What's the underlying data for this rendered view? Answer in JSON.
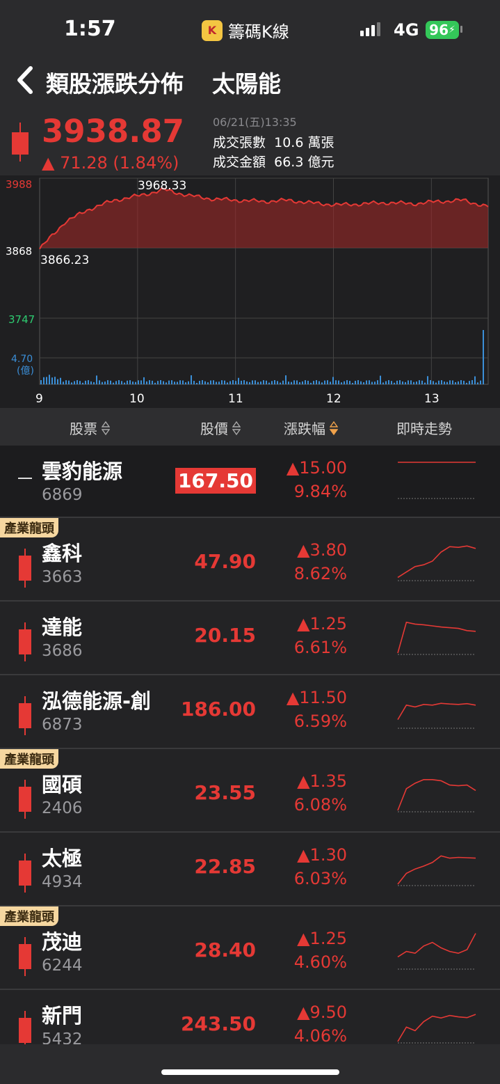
{
  "status": {
    "time": "1:57",
    "app_name": "籌碼K線",
    "network": "4G",
    "battery": "96"
  },
  "nav": {
    "title": "類股漲跌分佈",
    "sector": "太陽能"
  },
  "quote": {
    "price": "3938.87",
    "change": "▲ 71.28 (1.84%)",
    "time": "06/21(五)13:35",
    "volume_label": "成交張數",
    "volume": "10.6 萬張",
    "amount_label": "成交金額",
    "amount": "66.3 億元"
  },
  "chart": {
    "y_top": "3988",
    "y_mid": "3868",
    "y_low": "3747",
    "high_label": "3968.33",
    "low_label": "3866.23",
    "vol_label": "4.70",
    "vol_unit": "(億)",
    "x_labels": [
      "9",
      "10",
      "11",
      "12",
      "13"
    ]
  },
  "chart_data": {
    "type": "area",
    "ylim": [
      3747,
      3988
    ],
    "reference": 3868,
    "high": 3968.33,
    "low": 3866.23,
    "x": [
      "9:00",
      "9:15",
      "9:30",
      "9:45",
      "10:00",
      "10:15",
      "10:30",
      "10:45",
      "11:00",
      "11:15",
      "11:30",
      "11:45",
      "12:00",
      "12:15",
      "12:30",
      "12:45",
      "13:00",
      "13:15",
      "13:30"
    ],
    "values": [
      3866.23,
      3912,
      3935,
      3950,
      3958,
      3968.33,
      3958,
      3952,
      3950,
      3948,
      3950,
      3945,
      3942,
      3944,
      3946,
      3944,
      3948,
      3950,
      3938.87
    ],
    "volume_max": 4.7
  },
  "list_header": {
    "col_stock": "股票",
    "col_price": "股價",
    "col_change": "漲跌幅",
    "col_trend": "即時走勢"
  },
  "rows": [
    {
      "name": "雲豹能源",
      "code": "6869",
      "price": "167.50",
      "change": "▲15.00",
      "pct": "9.84%",
      "badge": "",
      "limit": true,
      "candle": "dash",
      "spark": [
        0,
        0,
        0,
        0,
        0,
        0,
        0,
        0,
        0,
        0
      ]
    },
    {
      "name": "鑫科",
      "code": "3663",
      "price": "47.90",
      "change": "▲3.80",
      "pct": "8.62%",
      "badge": "產業龍頭",
      "limit": false,
      "candle": "bar",
      "spark": [
        0.05,
        0.2,
        0.35,
        0.4,
        0.5,
        0.75,
        0.9,
        0.88,
        0.92,
        0.85
      ]
    },
    {
      "name": "達能",
      "code": "3686",
      "price": "20.15",
      "change": "▲1.25",
      "pct": "6.61%",
      "badge": "",
      "limit": false,
      "candle": "bar",
      "spark": [
        0.0,
        0.85,
        0.8,
        0.78,
        0.75,
        0.72,
        0.7,
        0.68,
        0.62,
        0.6
      ]
    },
    {
      "name": "泓德能源-創",
      "code": "6873",
      "price": "186.00",
      "change": "▲11.50",
      "pct": "6.59%",
      "badge": "",
      "limit": false,
      "candle": "bar",
      "spark": [
        0.2,
        0.6,
        0.55,
        0.62,
        0.6,
        0.65,
        0.63,
        0.62,
        0.64,
        0.6
      ]
    },
    {
      "name": "國碩",
      "code": "2406",
      "price": "23.55",
      "change": "▲1.35",
      "pct": "6.08%",
      "badge": "產業龍頭",
      "limit": false,
      "candle": "bar",
      "spark": [
        0.0,
        0.6,
        0.75,
        0.85,
        0.85,
        0.82,
        0.7,
        0.68,
        0.7,
        0.55
      ]
    },
    {
      "name": "太極",
      "code": "4934",
      "price": "22.85",
      "change": "▲1.30",
      "pct": "6.03%",
      "badge": "",
      "limit": false,
      "candle": "bar",
      "spark": [
        0.0,
        0.3,
        0.42,
        0.5,
        0.6,
        0.78,
        0.72,
        0.74,
        0.73,
        0.72
      ]
    },
    {
      "name": "茂迪",
      "code": "6244",
      "price": "28.40",
      "change": "▲1.25",
      "pct": "4.60%",
      "badge": "產業龍頭",
      "limit": false,
      "candle": "bar",
      "spark": [
        0.3,
        0.45,
        0.4,
        0.6,
        0.7,
        0.55,
        0.45,
        0.4,
        0.5,
        0.95
      ]
    },
    {
      "name": "新門",
      "code": "5432",
      "price": "243.50",
      "change": "▲9.50",
      "pct": "4.06%",
      "badge": "",
      "limit": false,
      "candle": "bar",
      "spark": [
        0.0,
        0.4,
        0.3,
        0.55,
        0.7,
        0.65,
        0.72,
        0.68,
        0.66,
        0.75
      ]
    }
  ],
  "colors": {
    "up": "#e53935",
    "down": "#2ecc71",
    "accent": "#f0a24b",
    "badge": "#f6d7a0"
  }
}
